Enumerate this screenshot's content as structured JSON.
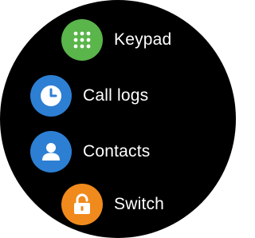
{
  "menu": {
    "items": [
      {
        "label": "Keypad",
        "icon": "keypad-icon",
        "color": "#5ab54a"
      },
      {
        "label": "Call logs",
        "icon": "clock-icon",
        "color": "#2d7fd4"
      },
      {
        "label": "Contacts",
        "icon": "contact-icon",
        "color": "#2d7fd4"
      },
      {
        "label": "Switch",
        "icon": "lock-icon",
        "color": "#f08a1c"
      }
    ]
  },
  "colors": {
    "background": "#000000",
    "text": "#ffffff"
  }
}
